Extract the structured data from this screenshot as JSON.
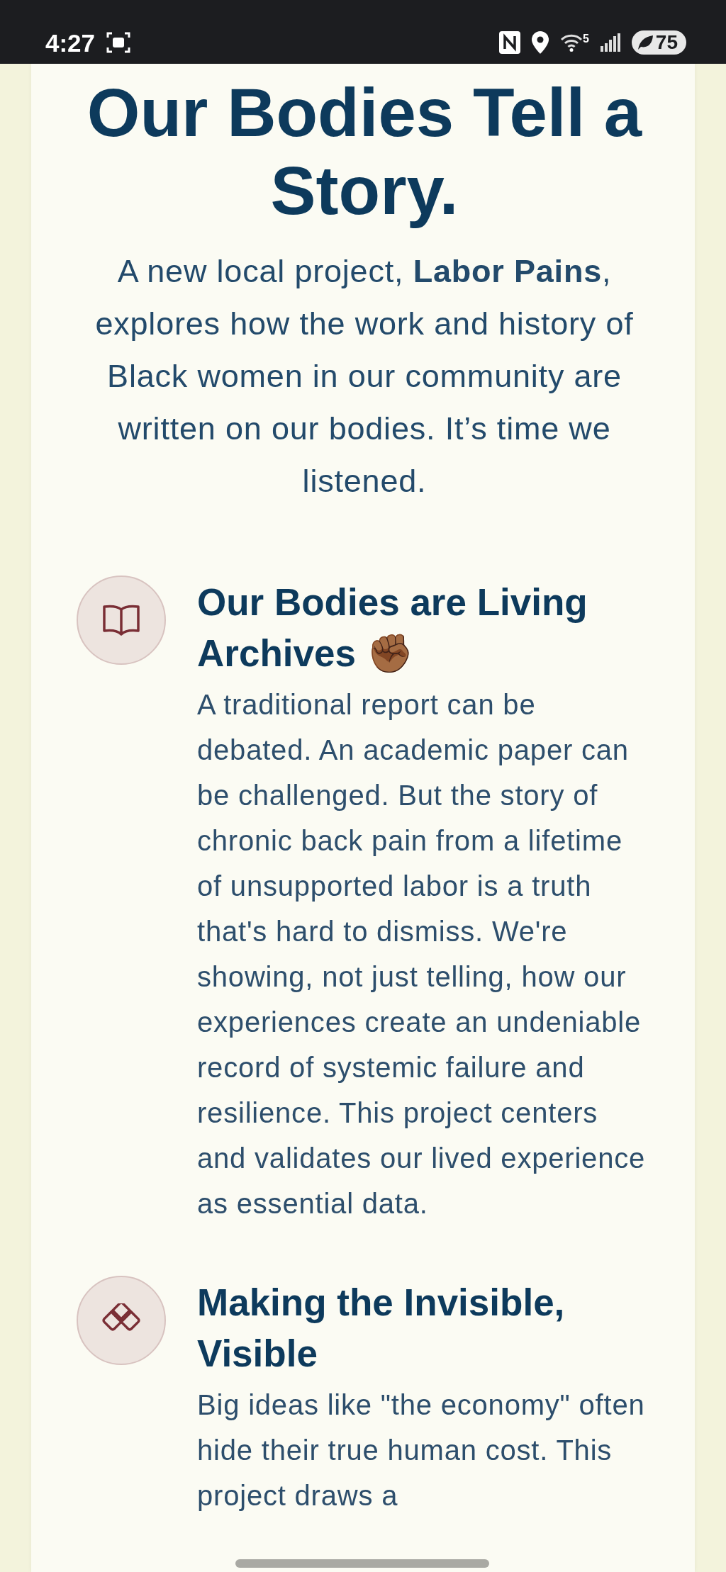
{
  "status_bar": {
    "time": "4:27",
    "wifi_badge": "5",
    "battery": "75"
  },
  "hero": {
    "title": "Our Bodies Tell a Story.",
    "intro": "A new local project, **Labor Pains**, explores how the work and history of Black women in our community are written on our bodies. It’s time we listened."
  },
  "features": [
    {
      "kind": "book",
      "title": "Our Bodies are Living Archives ✊🏾",
      "body": "A traditional report can be debated. An academic paper can be challenged. But the story of chronic back pain from a lifetime of unsupported labor is a truth that's hard to dismiss. We're showing, not just telling, how our experiences create an undeniable record of systemic failure and resilience. This project centers and validates our lived experience as essential data."
    },
    {
      "kind": "diamonds",
      "title": "Making the Invisible, Visible",
      "body": "Big ideas like \"the economy\" often hide their true human cost. This project draws a"
    }
  ]
}
